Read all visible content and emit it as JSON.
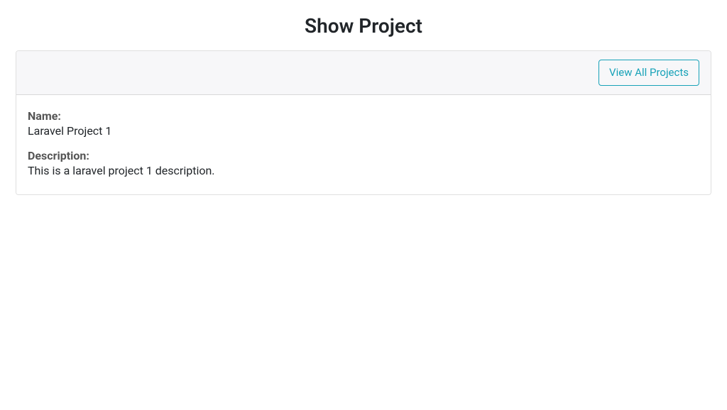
{
  "header": {
    "title": "Show Project"
  },
  "card": {
    "view_all_button": "View All Projects"
  },
  "project": {
    "name_label": "Name:",
    "name_value": "Laravel Project 1",
    "description_label": "Description:",
    "description_value": "This is a laravel project 1 description."
  }
}
